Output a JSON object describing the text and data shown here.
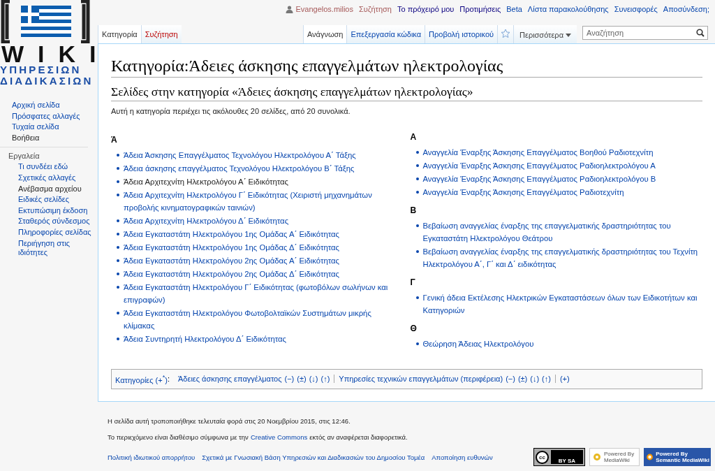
{
  "logo": {
    "word": "WIKI",
    "line1": "ΥΠΗΡΕΣΙΩΝ",
    "line2": "ΔΙΑΔΙΚΑΣΙΩΝ"
  },
  "personal": [
    {
      "label": "Evangelos.milios",
      "kind": "user"
    },
    {
      "label": "Συζήτηση",
      "kind": "new"
    },
    {
      "label": "Το πρόχειρό μου",
      "kind": "visited"
    },
    {
      "label": "Προτιμήσεις",
      "kind": "visited"
    },
    {
      "label": "Beta",
      "kind": "link"
    },
    {
      "label": "Λίστα παρακολούθησης",
      "kind": "link"
    },
    {
      "label": "Συνεισφορές",
      "kind": "link"
    },
    {
      "label": "Αποσύνδεση;",
      "kind": "link"
    }
  ],
  "left_tabs": [
    {
      "label": "Κατηγορία",
      "selected": true,
      "new": false
    },
    {
      "label": "Συζήτηση",
      "selected": false,
      "new": true
    }
  ],
  "right_tabs": [
    {
      "label": "Ανάγνωση",
      "selected": true
    },
    {
      "label": "Επεξεργασία κώδικα",
      "selected": false
    },
    {
      "label": "Προβολή ιστορικού",
      "selected": false
    }
  ],
  "more_menu": "Περισσότερα",
  "search": {
    "placeholder": "Αναζήτηση"
  },
  "sidebar": {
    "nav": [
      {
        "label": "Αρχική σελίδα",
        "visited": false
      },
      {
        "label": "Πρόσφατες αλλαγές",
        "visited": false
      },
      {
        "label": "Τυχαία σελίδα",
        "visited": false
      },
      {
        "label": "Βοήθεια",
        "visited": true
      }
    ],
    "tools_heading": "Εργαλεία",
    "tools": [
      {
        "label": "Τι συνδέει εδώ",
        "visited": false
      },
      {
        "label": "Σχετικές αλλαγές",
        "visited": false
      },
      {
        "label": "Ανέβασμα αρχείου",
        "visited": true
      },
      {
        "label": "Ειδικές σελίδες",
        "visited": false
      },
      {
        "label": "Εκτυπώσιμη έκδοση",
        "visited": false
      },
      {
        "label": "Σταθερός σύνδεσμος",
        "visited": false
      },
      {
        "label": "Πληροφορίες σελίδας",
        "visited": false
      },
      {
        "label": "Περιήγηση στις ιδιότητες",
        "visited": false
      }
    ]
  },
  "page_title": "Κατηγορία:Άδειες άσκησης επαγγελμάτων ηλεκτρολογίας",
  "section_heading": "Σελίδες στην κατηγορία «Άδειες άσκησης επαγγελμάτων ηλεκτρολογίας»",
  "summary": "Αυτή η κατηγορία περιέχει τις ακόλουθες 20 σελίδες, από 20 συνολικά.",
  "columns": [
    [
      {
        "letter": "Ά",
        "pages": [
          {
            "title": "Άδεια Άσκησης Επαγγέλματος Τεχνολόγου Ηλεκτρολόγου Α΄ Τάξης",
            "visited": false
          },
          {
            "title": "Άδεια άσκησης επαγγέλματος Τεχνολόγου Ηλεκτρολόγου Β΄ Τάξης",
            "visited": false
          },
          {
            "title": "Άδεια Αρχιτεχνίτη Ηλεκτρολόγου Α΄ Ειδικότητας",
            "visited": true
          },
          {
            "title": "Άδεια Αρχιτεχνίτη Ηλεκτρολόγου Γ΄ Ειδικότητας (Χειριστή μηχανημάτων προβολής κινηματογραφικών ταινιών)",
            "visited": false
          },
          {
            "title": "Άδεια Αρχιτεχνίτη Ηλεκτρολόγου Δ΄ Ειδικότητας",
            "visited": false
          },
          {
            "title": "Άδεια Εγκαταστάτη Ηλεκτρολόγου 1ης Ομάδας Α΄ Ειδικότητας",
            "visited": false
          },
          {
            "title": "Άδεια Εγκαταστάτη Ηλεκτρολόγου 1ης Ομάδας Δ΄ Ειδικότητας",
            "visited": false
          },
          {
            "title": "Άδεια Εγκαταστάτη Ηλεκτρολόγου 2ης Ομάδας Α΄ Ειδικότητας",
            "visited": false
          },
          {
            "title": "Άδεια Εγκαταστάτη Ηλεκτρολόγου 2ης Ομάδας Δ΄ Ειδικότητας",
            "visited": false
          },
          {
            "title": "Άδεια Εγκαταστάτη Ηλεκτρολόγου Γ΄ Ειδικότητας (φωτοβόλων σωλήνων και επιγραφών)",
            "visited": false
          },
          {
            "title": "Άδεια Εγκαταστάτη Ηλεκτρολόγου Φωτοβολταϊκών Συστημάτων μικρής κλίμακας",
            "visited": false
          },
          {
            "title": "Άδεια Συντηρητή Ηλεκτρολόγου Δ΄ Ειδικότητας",
            "visited": false
          }
        ]
      }
    ],
    [
      {
        "letter": "Α",
        "pages": [
          {
            "title": "Αναγγελία Έναρξης Άσκησης Επαγγέλματος Βοηθού Ραδιοτεχνίτη",
            "visited": false
          },
          {
            "title": "Αναγγελία Έναρξης Άσκησης Επαγγέλματος Ραδιοηλεκτρολόγου Α",
            "visited": false
          },
          {
            "title": "Αναγγελία Έναρξης Άσκησης Επαγγέλματος Ραδιοηλεκτρολόγου Β",
            "visited": false
          },
          {
            "title": "Αναγγελία Έναρξης Άσκησης Επαγγέλματος Ραδιοτεχνίτη",
            "visited": false
          }
        ]
      },
      {
        "letter": "Β",
        "pages": [
          {
            "title": "Βεβαίωση αναγγελίας έναρξης της επαγγελματικής δραστηριότητας του Εγκαταστάτη Ηλεκτρολόγου Θεάτρου",
            "visited": false
          },
          {
            "title": "Βεβαίωση αναγγελίας έναρξης της επαγγελματικής δραστηριότητας του Τεχνίτη Ηλεκτρολόγου Α΄, Γ΄ και Δ΄ ειδικότητας",
            "visited": false
          }
        ]
      },
      {
        "letter": "Γ",
        "pages": [
          {
            "title": "Γενική άδεια Εκτέλεσης Ηλεκτρικών Εγκαταστάσεων όλων των Ειδικοτήτων και Κατηγοριών",
            "visited": false
          }
        ]
      },
      {
        "letter": "Θ",
        "pages": [
          {
            "title": "Θεώρηση Άδειας Ηλεκτρολόγου",
            "visited": false
          }
        ]
      }
    ]
  ],
  "catlinks": {
    "label": "Κατηγορίες (+$^{*}$)",
    "colon": ":",
    "categories": [
      {
        "name": "Άδειες άσκησης επαγγέλματος",
        "actions": [
          "(−)",
          "(±)",
          "(↓)",
          "(↑)"
        ]
      },
      {
        "name": "Υπηρεσίες τεχνικών επαγγελμάτων (περιφέρεια)",
        "actions": [
          "(−)",
          "(±)",
          "(↓)",
          "(↑)"
        ]
      }
    ],
    "add": "(+)"
  },
  "footer": {
    "last_modified": "Η σελίδα αυτή τροποποιήθηκε τελευταία φορά στις 20 Νοεμβρίου 2015, στις 12:46.",
    "license_before": "Το περιεχόμενο είναι διαθέσιμο σύμφωνα με την",
    "license_link": "Creative Commons",
    "license_after": "εκτός αν αναφέρεται διαφορετικά.",
    "links": [
      "Πολιτική ιδιωτικού απορρήτου",
      "Σχετικά με Γνωσιακή Βάση Υπηρεσιών και Διαδικασιών του Δημοσίου Τομέα",
      "Αποποίηση ευθυνών"
    ],
    "badges": [
      {
        "kind": "cc",
        "text": "BY SA"
      },
      {
        "kind": "mediawiki",
        "small": "Powered By",
        "text": "MediaWiki"
      },
      {
        "kind": "smw",
        "small": "Powered By",
        "text": "Semantic MediaWiki"
      }
    ]
  }
}
